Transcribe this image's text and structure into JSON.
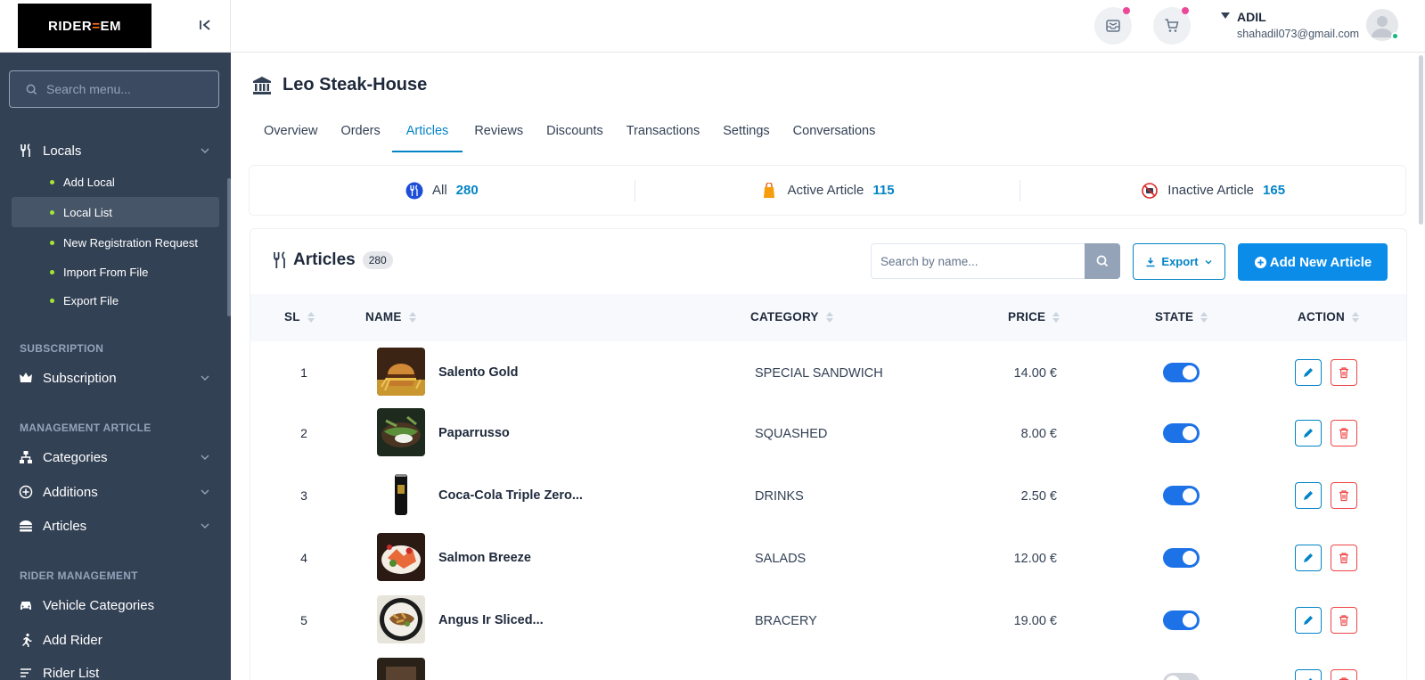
{
  "brand": {
    "logo_text": "RIDER",
    "logo_accent": "EM"
  },
  "sidebar": {
    "search_placeholder": "Search menu...",
    "locals": {
      "label": "Locals",
      "items": [
        "Add Local",
        "Local List",
        "New Registration Request",
        "Import From File",
        "Export File"
      ],
      "active_index": 1
    },
    "sections": [
      {
        "title": "SUBSCRIPTION",
        "items": [
          "Subscription"
        ]
      },
      {
        "title": "MANAGEMENT ARTICLE",
        "items": [
          "Categories",
          "Additions",
          "Articles"
        ]
      },
      {
        "title": "RIDER MANAGEMENT",
        "items": [
          "Vehicle Categories",
          "Add Rider",
          "Rider List"
        ]
      }
    ]
  },
  "topbar": {
    "user_name": "ADIL",
    "user_email": "shahadil073@gmail.com",
    "colors": {
      "badge": "#ec4899",
      "online": "#10b981"
    }
  },
  "page": {
    "title": "Leo Steak-House",
    "tabs": [
      "Overview",
      "Orders",
      "Articles",
      "Reviews",
      "Discounts",
      "Transactions",
      "Settings",
      "Conversations"
    ],
    "active_tab": 2
  },
  "stats": [
    {
      "label": "All",
      "value": "280"
    },
    {
      "label": "Active Article",
      "value": "115"
    },
    {
      "label": "Inactive Article",
      "value": "165"
    }
  ],
  "articles": {
    "title": "Articles",
    "count": "280",
    "search_placeholder": "Search by name...",
    "export_label": "Export",
    "add_label": "Add New Article",
    "columns": [
      "SL",
      "NAME",
      "CATEGORY",
      "PRICE",
      "STATE",
      "ACTION"
    ],
    "rows": [
      {
        "sl": "1",
        "name": "Salento Gold",
        "category": "SPECIAL SANDWICH",
        "price": "14.00 €",
        "active": true
      },
      {
        "sl": "2",
        "name": "Paparrusso",
        "category": "SQUASHED",
        "price": "8.00 €",
        "active": true
      },
      {
        "sl": "3",
        "name": "Coca-Cola Triple Zero...",
        "category": "DRINKS",
        "price": "2.50 €",
        "active": true
      },
      {
        "sl": "4",
        "name": "Salmon Breeze",
        "category": "SALADS",
        "price": "12.00 €",
        "active": true
      },
      {
        "sl": "5",
        "name": "Angus Ir Sliced...",
        "category": "BRACERY",
        "price": "19.00 €",
        "active": true
      },
      {
        "sl": "",
        "name": "",
        "category": "",
        "price": "",
        "active": false
      }
    ]
  },
  "colors": {
    "accent": "#0284c7",
    "primary_button": "#0a8ce8",
    "sidebar_bg": "#334155",
    "toggle_on": "#1d72e8",
    "delete": "#ef4444"
  }
}
